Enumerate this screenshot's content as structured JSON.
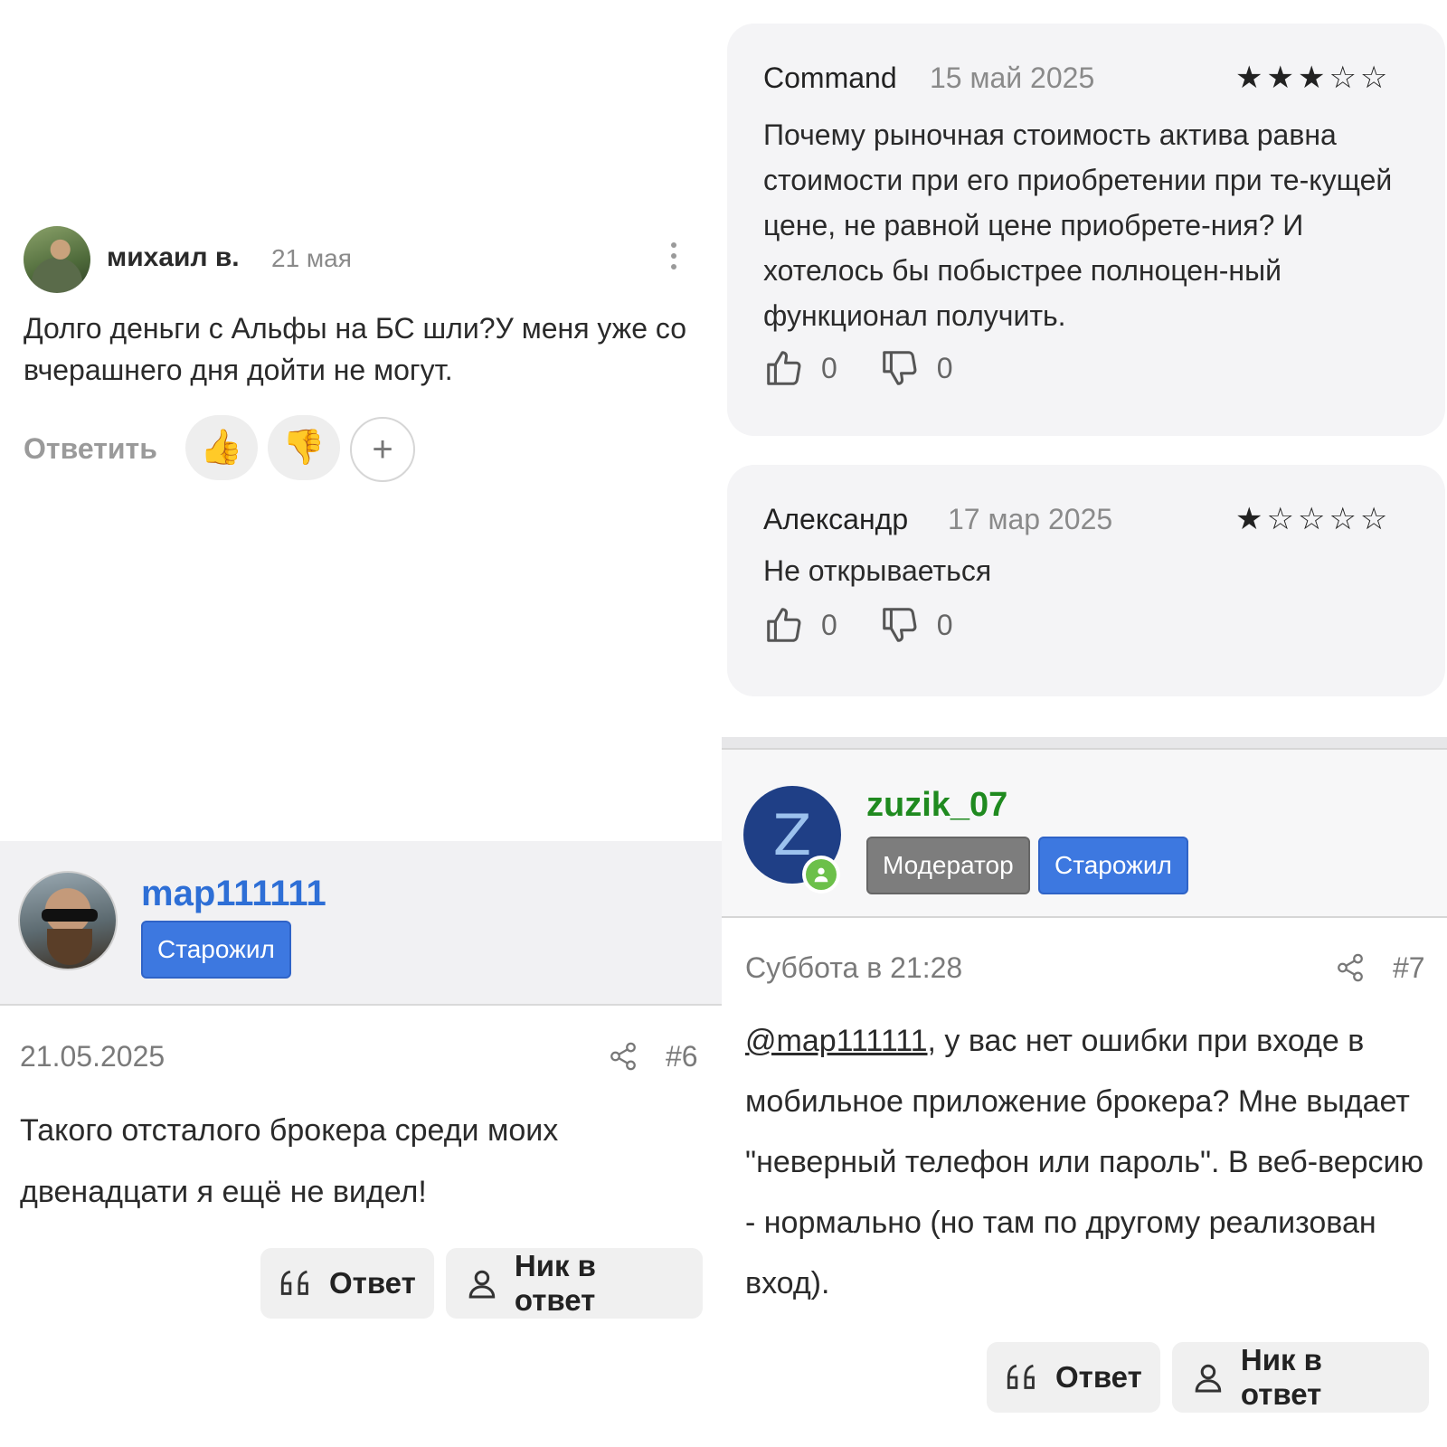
{
  "comment": {
    "author": "михаил в.",
    "date": "21 мая",
    "text": "Долго деньги с Альфы на БС шли?У меня уже со вчерашнего дня дойти не могут.",
    "reply_label": "Ответить",
    "reaction_like_icon": "thumbs-up-emoji",
    "reaction_dislike_icon": "thumbs-down-emoji",
    "add_reaction_label": "+"
  },
  "reviews": [
    {
      "author": "Command",
      "date": "15 май 2025",
      "rating": 3,
      "stars": "★★★☆☆",
      "text": "Почему рыночная стоимость актива равна стоимости при его приобретении при те-кущей цене, не равной цене приобрете-ния? И хотелось бы побыстрее полноцен-ный функционал получить.",
      "likes": "0",
      "dislikes": "0"
    },
    {
      "author": "Александр",
      "date": "17 мар 2025",
      "rating": 1,
      "stars": "★☆☆☆☆",
      "text": "Не открываеться",
      "likes": "0",
      "dislikes": "0"
    }
  ],
  "posts": [
    {
      "author": "map111111",
      "badges": [
        "Старожил"
      ],
      "date": "21.05.2025",
      "number": "#6",
      "text": "Такого отсталого брокера среди моих двенадцати я ещё не видел!",
      "quote_button": "Ответ",
      "nick_button": "Ник в ответ"
    },
    {
      "author": "zuzik_07",
      "avatar_letter": "Z",
      "badges": [
        "Модератор",
        "Старожил"
      ],
      "date": "Суббота в 21:28",
      "number": "#7",
      "mention": "@map111111",
      "text": ", у вас нет ошибки при входе в мобильное приложение брокера? Мне выдает \"неверный телефон или пароль\". В веб-версию - нормально (но там по другому реализован вход).",
      "quote_button": "Ответ",
      "nick_button": "Ник в ответ"
    }
  ],
  "colors": {
    "username_blue": "#2e6fd6",
    "username_green": "#1f8a1f",
    "badge_blue": "#3d78e0",
    "badge_gray": "#7d7d7d",
    "review_bg": "#f4f4f6"
  }
}
